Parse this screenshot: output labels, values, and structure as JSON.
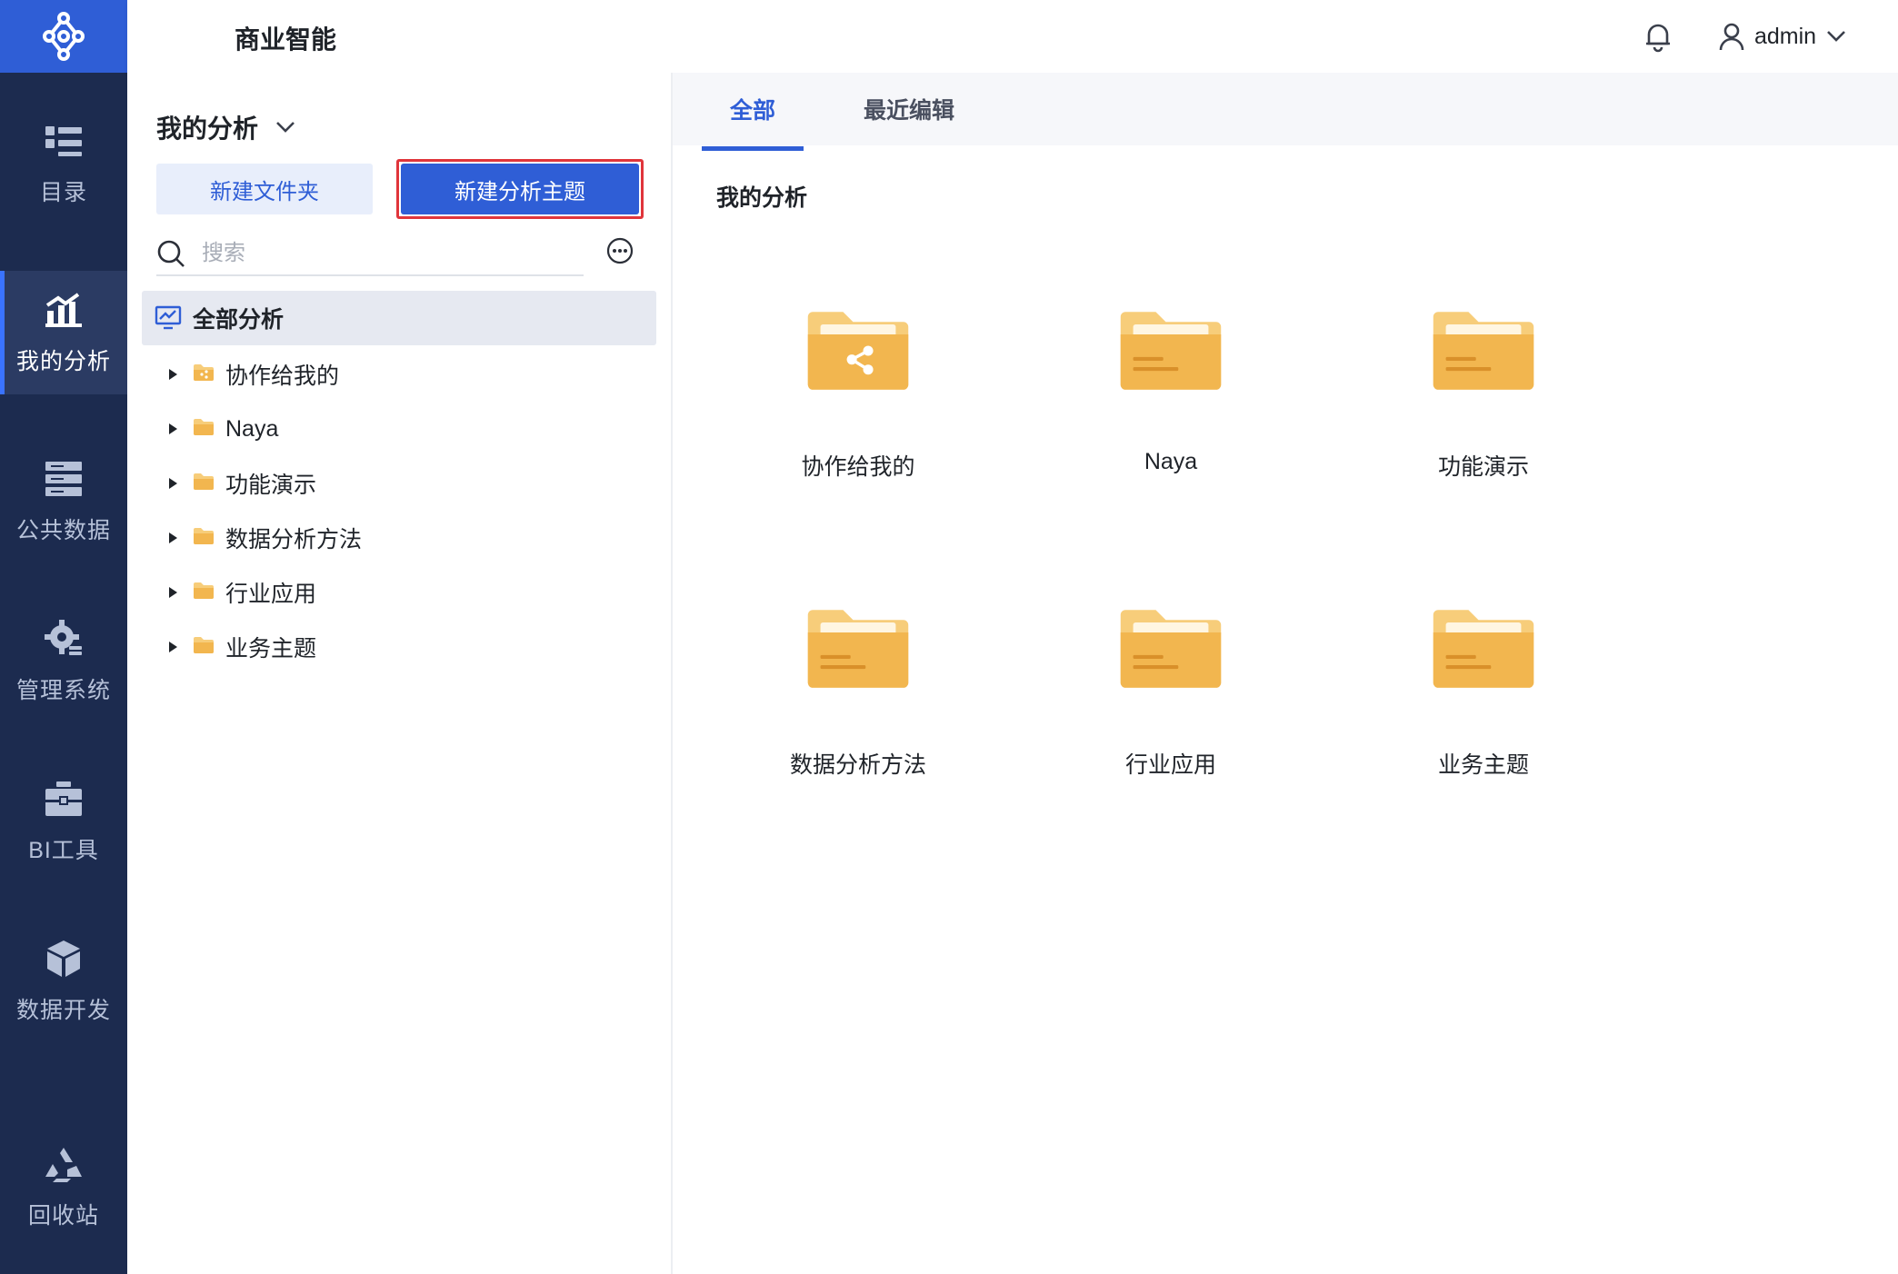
{
  "app": {
    "title": "商业智能"
  },
  "rail": {
    "items": [
      {
        "label": "目录",
        "icon": "catalog-icon"
      },
      {
        "label": "我的分析",
        "icon": "analysis-chart-icon",
        "active": true
      },
      {
        "label": "公共数据",
        "icon": "public-data-icon"
      },
      {
        "label": "管理系统",
        "icon": "gear-icon"
      },
      {
        "label": "BI工具",
        "icon": "toolbox-icon"
      },
      {
        "label": "数据开发",
        "icon": "cube-icon"
      },
      {
        "label": "回收站",
        "icon": "recycle-icon"
      }
    ]
  },
  "topbar": {
    "user": "admin"
  },
  "panel": {
    "title": "我的分析",
    "new_folder_label": "新建文件夹",
    "new_theme_label": "新建分析主题",
    "search_placeholder": "搜索",
    "tree_root": "全部分析",
    "tree_items": [
      {
        "label": "协作给我的",
        "shared": true
      },
      {
        "label": "Naya"
      },
      {
        "label": "功能演示"
      },
      {
        "label": "数据分析方法"
      },
      {
        "label": "行业应用"
      },
      {
        "label": "业务主题"
      }
    ]
  },
  "content": {
    "tabs": [
      {
        "label": "全部",
        "active": true
      },
      {
        "label": "最近编辑"
      }
    ],
    "section_title": "我的分析",
    "folders": [
      {
        "label": "协作给我的",
        "shared": true
      },
      {
        "label": "Naya"
      },
      {
        "label": "功能演示"
      },
      {
        "label": "数据分析方法"
      },
      {
        "label": "行业应用"
      },
      {
        "label": "业务主题"
      }
    ]
  },
  "colors": {
    "rail_bg": "#1c2b4f",
    "accent": "#2f5ed6",
    "folder": "#f2b64f",
    "highlight_border": "#e0353b"
  }
}
